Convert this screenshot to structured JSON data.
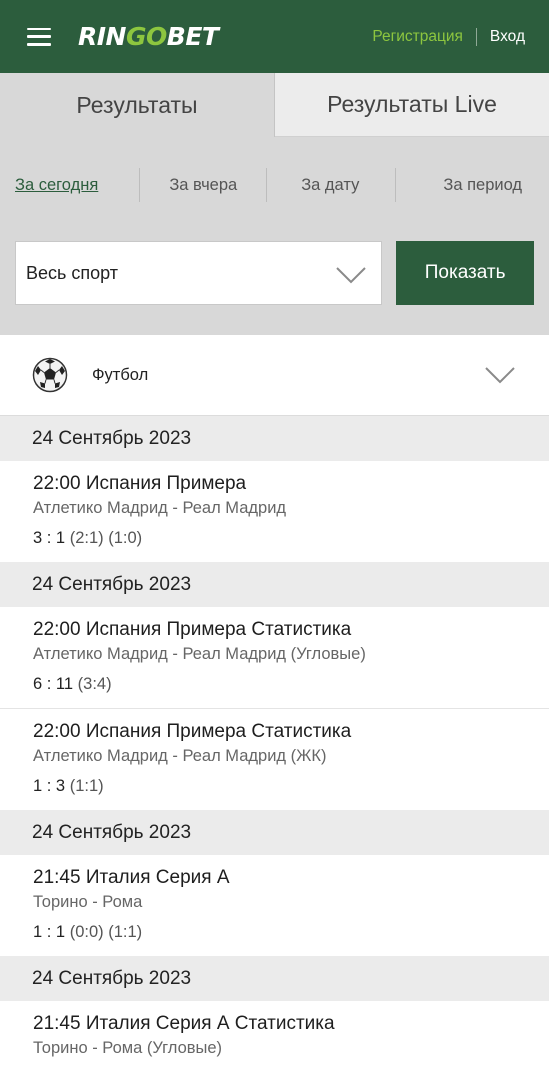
{
  "header": {
    "logo_left": "RIN",
    "logo_go": "GO",
    "logo_right": "BET",
    "register": "Регистрация",
    "login": "Вход",
    "colors": {
      "brand_green": "#2c5d3d",
      "accent_green": "#8dc63f"
    },
    "menu_icon": "hamburger-icon"
  },
  "tabs": [
    {
      "label": "Результаты",
      "active": true
    },
    {
      "label": "Результаты Live",
      "active": false
    }
  ],
  "periods": [
    {
      "label": "За сегодня",
      "active": true
    },
    {
      "label": "За вчера",
      "active": false
    },
    {
      "label": "За дату",
      "active": false
    },
    {
      "label": "За период",
      "active": false
    }
  ],
  "filter": {
    "sport_select_value": "Весь спорт",
    "show_button": "Показать"
  },
  "sport": {
    "name": "Футбол",
    "icon": "soccer-ball-icon"
  },
  "results": [
    {
      "date": "24 Сентябрь 2023",
      "matches": [
        {
          "time": "22:00",
          "league": "Испания Примера",
          "teams": "Атлетико Мадрид - Реал Мадрид",
          "score_main": "3 : 1",
          "score_extra": "(2:1) (1:0)"
        }
      ]
    },
    {
      "date": "24 Сентябрь 2023",
      "matches": [
        {
          "time": "22:00",
          "league": "Испания Примера Статистика",
          "teams": "Атлетико Мадрид - Реал Мадрид (Угловые)",
          "score_main": "6 : 11",
          "score_extra": "(3:4)"
        },
        {
          "time": "22:00",
          "league": "Испания Примера Статистика",
          "teams": "Атлетико Мадрид - Реал Мадрид (ЖК)",
          "score_main": "1 : 3",
          "score_extra": "(1:1)"
        }
      ]
    },
    {
      "date": "24 Сентябрь 2023",
      "matches": [
        {
          "time": "21:45",
          "league": "Италия Серия А",
          "teams": "Торино - Рома",
          "score_main": "1 : 1",
          "score_extra": "(0:0) (1:1)"
        }
      ]
    },
    {
      "date": "24 Сентябрь 2023",
      "matches": [
        {
          "time": "21:45",
          "league": "Италия Серия А Статистика",
          "teams": "Торино - Рома (Угловые)",
          "score_main": "",
          "score_extra": ""
        }
      ]
    }
  ]
}
